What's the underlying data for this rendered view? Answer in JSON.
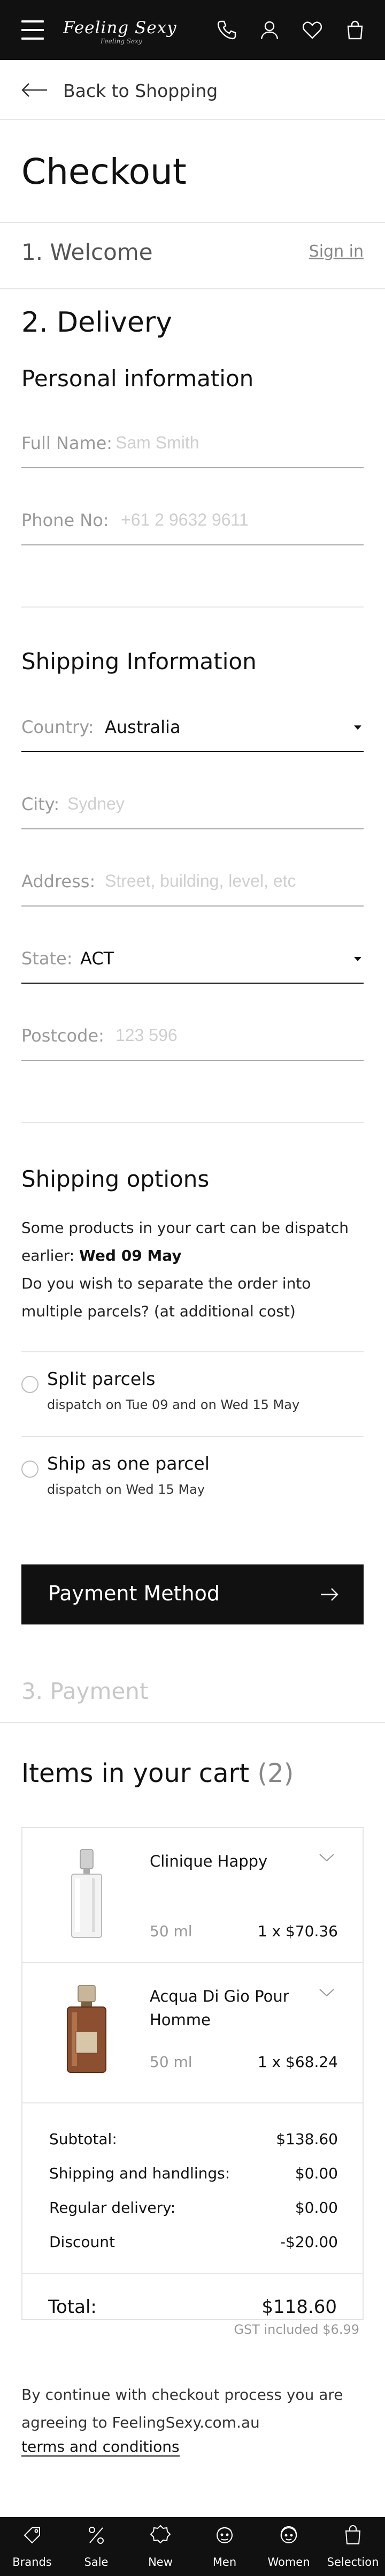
{
  "header": {
    "logo_text": "Feeling Sexy",
    "logo_sub": "Feeling Sexy",
    "icons": [
      "menu-icon",
      "phone-icon",
      "user-icon",
      "heart-icon",
      "bag-icon"
    ]
  },
  "back_label": "Back to Shopping",
  "page_title": "Checkout",
  "step1": {
    "title": "1. Welcome",
    "signin": "Sign in"
  },
  "step2": {
    "title": "2. Delivery"
  },
  "personal": {
    "heading": "Personal information",
    "full_name_label": "Full Name:",
    "full_name_placeholder": "Sam Smith",
    "phone_label": "Phone No:",
    "phone_placeholder": "+61 2 9632 9611"
  },
  "shipping_info": {
    "heading": "Shipping Information",
    "country_label": "Country:",
    "country_value": "Australia",
    "city_label": "City:",
    "city_placeholder": "Sydney",
    "address_label": "Address:",
    "address_placeholder": "Street, building, level, etc",
    "state_label": "State:",
    "state_value": "ACT",
    "postcode_label": "Postcode:",
    "postcode_placeholder": "123 596"
  },
  "shipping_options": {
    "heading": "Shipping options",
    "line1": "Some products in your cart can be dispatch",
    "line2_prefix": "earlier:",
    "line2_date": "Wed 09 May",
    "line3": "Do you wish to separate the order into",
    "line4": "multiple parcels? (at additional cost)",
    "options": [
      {
        "title": "Split parcels",
        "sub": "dispatch on Tue 09 and on Wed 15 May"
      },
      {
        "title": "Ship as one parcel",
        "sub": "dispatch on Wed 15 May"
      }
    ]
  },
  "payment_button": "Payment Method",
  "step3": {
    "title": "3. Payment"
  },
  "cart": {
    "heading": "Items in your cart",
    "count": "(2)",
    "items": [
      {
        "name": "Clinique Happy",
        "size": "50 ml",
        "price": "1 x $70.36"
      },
      {
        "name": "Acqua Di Gio Pour Homme",
        "size": "50 ml",
        "price": "1 x $68.24"
      }
    ],
    "summary": [
      {
        "label": "Subtotal:",
        "value": "$138.60"
      },
      {
        "label": "Shipping and handlings:",
        "value": "$0.00"
      },
      {
        "label": "Regular delivery:",
        "value": "$0.00"
      },
      {
        "label": "Discount",
        "value": "-$20.00"
      }
    ],
    "total_label": "Total:",
    "total_value": "$118.60",
    "gst": "GST included $6.99"
  },
  "terms": {
    "line1": "By continue with checkout process you are",
    "line2": "agreeing to FeelingSexy.com.au",
    "link": "terms and conditions"
  },
  "bottom_nav": [
    "Brands",
    "Sale",
    "New",
    "Men",
    "Women",
    "Selection"
  ]
}
